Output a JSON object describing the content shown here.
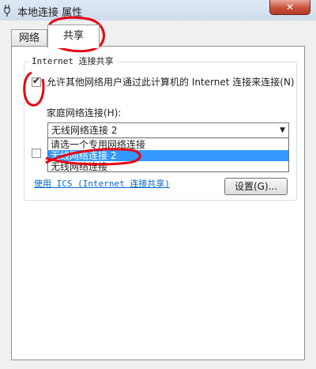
{
  "window": {
    "title": "本地连接 属性",
    "close_glyph": "✕"
  },
  "tabs": [
    {
      "label": "网络"
    },
    {
      "label": "共享"
    }
  ],
  "ics": {
    "group_title": "Internet 连接共享",
    "allow_checked": true,
    "check_glyph": "✔",
    "allow_label": "允许其他网络用户通过此计算机的 Internet 连接来连接(N)",
    "home_label": "家庭网络连接(H):",
    "selected": "无线网络连接 2",
    "dropdown_arrow": "▼",
    "options": [
      "请选一个专用网络连接",
      "无线网络连接 2",
      "无线网络连接"
    ],
    "link": "使用 ICS (Internet 连接共享)",
    "settings_button": "设置(G)..."
  },
  "annotation_color": "#e60012"
}
